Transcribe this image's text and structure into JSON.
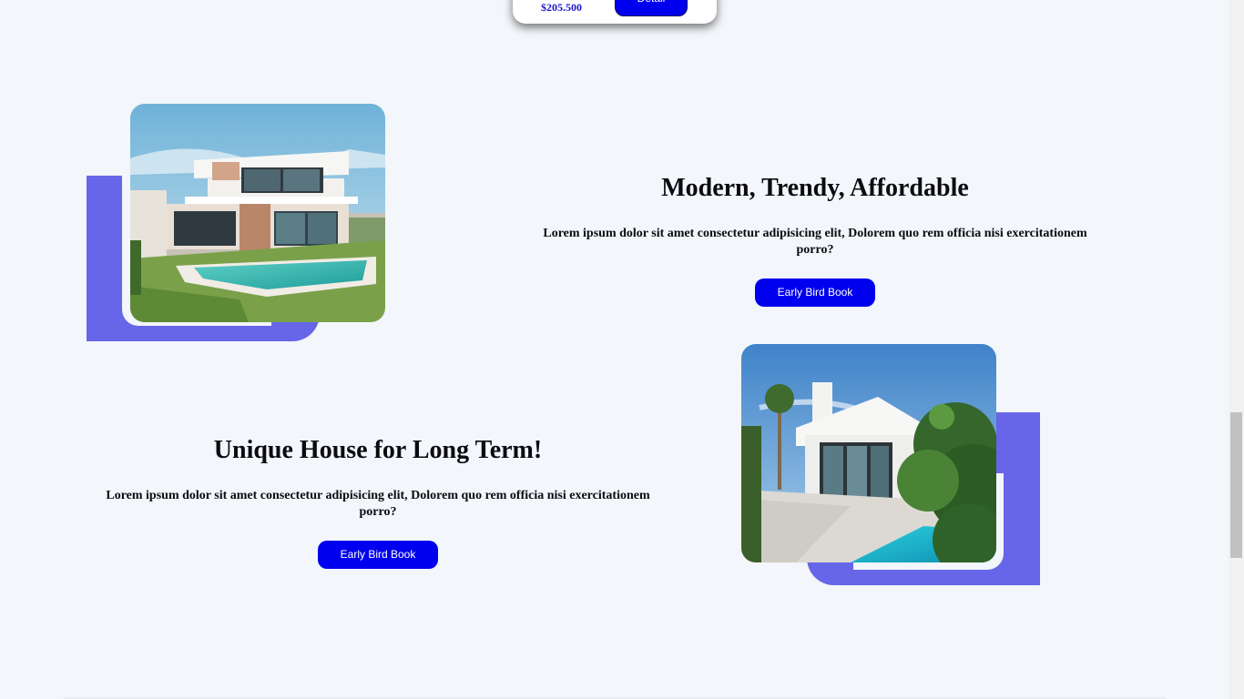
{
  "top_card": {
    "price": "$205.500",
    "detail_label": "Detail"
  },
  "features": [
    {
      "title": "Modern, Trendy, Affordable",
      "description": "Lorem ipsum dolor sit amet consectetur adipisicing elit, Dolorem quo rem officia nisi exercitationem porro?",
      "button_label": "Early Bird Book",
      "image_icon": "modern-house-photo"
    },
    {
      "title": "Unique House for Long Term!",
      "description": "Lorem ipsum dolor sit amet consectetur adipisicing elit, Dolorem quo rem officia nisi exercitationem porro?",
      "button_label": "Early Bird Book",
      "image_icon": "villa-pool-photo"
    }
  ],
  "colors": {
    "accent": "#6766e8",
    "button": "#0000ee",
    "price": "#1a17c9",
    "background": "#f3f6fa"
  }
}
